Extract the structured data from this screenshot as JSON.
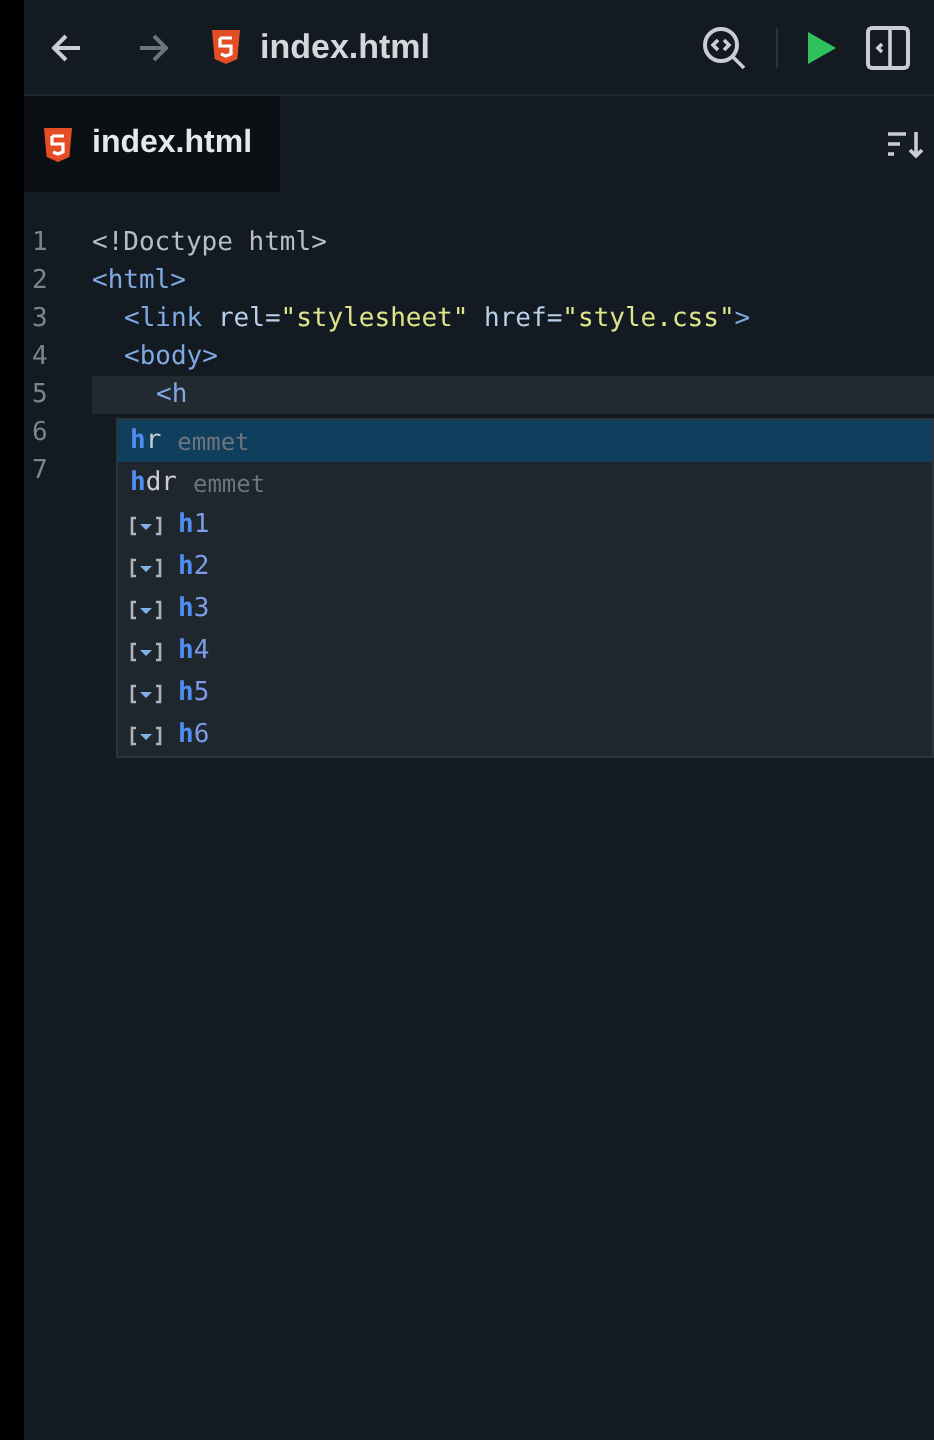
{
  "toolbar": {
    "title": "index.html"
  },
  "tab": {
    "label": "index.html",
    "selected": true
  },
  "editor": {
    "lines": [
      {
        "number": "1",
        "tokens": [
          {
            "kind": "plain",
            "text": "<!Doctype html>"
          }
        ]
      },
      {
        "number": "2",
        "tokens": [
          {
            "kind": "tag",
            "text": "<html>"
          }
        ],
        "children": [
          {
            "number": "3",
            "tokens": [
              {
                "kind": "tag",
                "text": "<link"
              },
              {
                "kind": "attr",
                "text": " rel="
              },
              {
                "kind": "string",
                "text": "\"stylesheet\""
              },
              {
                "kind": "attr",
                "text": " href="
              },
              {
                "kind": "string",
                "text": "\"style.css\""
              },
              {
                "kind": "tag",
                "text": ">"
              }
            ]
          },
          {
            "number": "4",
            "tokens": [
              {
                "kind": "tag",
                "text": "<body>"
              }
            ],
            "children": [
              {
                "number": "5",
                "current": true,
                "tokens": [
                  {
                    "kind": "tag",
                    "text": "<h"
                  }
                ]
              }
            ]
          }
        ]
      },
      {
        "number": "6"
      },
      {
        "number": "7"
      }
    ]
  },
  "suggestions": [
    {
      "kind": "emmet",
      "match": "h",
      "rest": "r",
      "detail": "emmet",
      "selected": true
    },
    {
      "kind": "emmet",
      "match": "h",
      "rest": "dr",
      "detail": "emmet",
      "selected": false
    },
    {
      "kind": "snippet",
      "match": "h",
      "rest": "1",
      "selected": false
    },
    {
      "kind": "snippet",
      "match": "h",
      "rest": "2",
      "selected": false
    },
    {
      "kind": "snippet",
      "match": "h",
      "rest": "3",
      "selected": false
    },
    {
      "kind": "snippet",
      "match": "h",
      "rest": "4",
      "selected": false
    },
    {
      "kind": "snippet",
      "match": "h",
      "rest": "5",
      "selected": false
    },
    {
      "kind": "snippet",
      "match": "h",
      "rest": "6",
      "selected": false
    }
  ]
}
